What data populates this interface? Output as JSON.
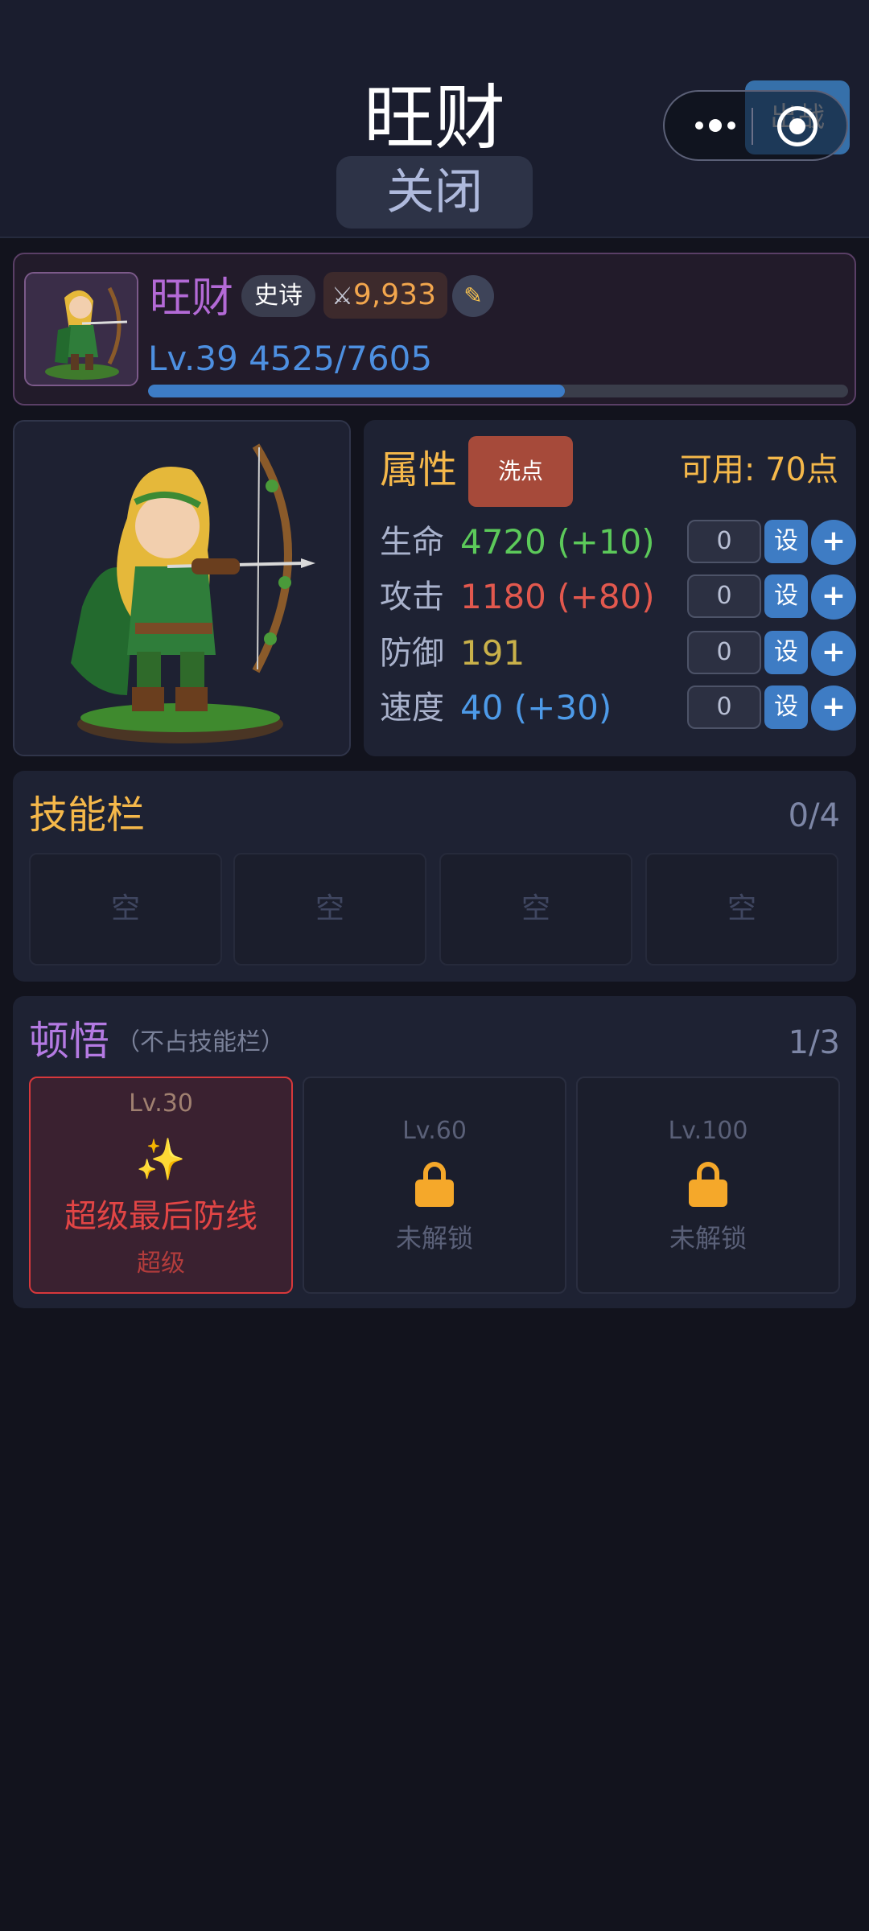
{
  "header": {
    "title": "旺财",
    "close_label": "关闭",
    "battle_label": "出战"
  },
  "profile": {
    "name": "旺财",
    "rarity": "史诗",
    "power_icon": "crossed-swords-icon",
    "power": "9,933",
    "edit_icon": "pencil-icon",
    "level_text": "Lv.39 4525/7605",
    "xp_current": 4525,
    "xp_max": 7605,
    "name_color": "#b36ad6",
    "xp_color": "#3d7cc6"
  },
  "attributes": {
    "title": "属性",
    "reset_label": "洗点",
    "available": "可用: 70点",
    "set_label": "设",
    "plus_label": "+",
    "stats": [
      {
        "label": "生命",
        "value": "4720 (+10)",
        "input": "0",
        "color": "#5cc95a"
      },
      {
        "label": "攻击",
        "value": "1180 (+80)",
        "input": "0",
        "color": "#e2584e"
      },
      {
        "label": "防御",
        "value": "191",
        "input": "0",
        "color": "#c9b14a"
      },
      {
        "label": "速度",
        "value": "40 (+30)",
        "input": "0",
        "color": "#4d9ae8"
      }
    ]
  },
  "skills": {
    "title": "技能栏",
    "count": "0/4",
    "slots": [
      "空",
      "空",
      "空",
      "空"
    ]
  },
  "enlightenment": {
    "title": "顿悟",
    "subtitle": "（不占技能栏）",
    "count": "1/3",
    "cards": [
      {
        "level": "Lv.30",
        "name": "超级最后防线",
        "tier": "超级",
        "icon": "sparkles-icon"
      },
      {
        "level": "Lv.60",
        "locked_text": "未解锁",
        "icon": "lock-icon"
      },
      {
        "level": "Lv.100",
        "locked_text": "未解锁",
        "icon": "lock-icon"
      }
    ]
  }
}
